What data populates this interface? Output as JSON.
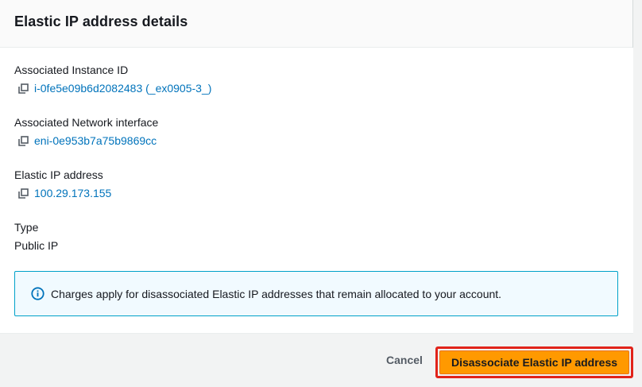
{
  "modal": {
    "title": "Elastic IP address details"
  },
  "fields": {
    "instance": {
      "label": "Associated Instance ID",
      "value": "i-0fe5e09b6d2082483 (_ex0905-3_)",
      "icon": "copy-icon"
    },
    "network_interface": {
      "label": "Associated Network interface",
      "value": "eni-0e953b7a75b9869cc",
      "icon": "copy-icon"
    },
    "elastic_ip": {
      "label": "Elastic IP address",
      "value": "100.29.173.155",
      "icon": "copy-icon"
    },
    "type": {
      "label": "Type",
      "value": "Public IP"
    }
  },
  "info_alert": {
    "icon": "info-icon",
    "text": "Charges apply for disassociated Elastic IP addresses that remain allocated to your account."
  },
  "footer": {
    "cancel_label": "Cancel",
    "primary_label": "Disassociate Elastic IP address"
  },
  "colors": {
    "link": "#0073bb",
    "primary": "#ff9900",
    "highlight_border": "#e1231a",
    "info_border": "#00a1c9"
  }
}
